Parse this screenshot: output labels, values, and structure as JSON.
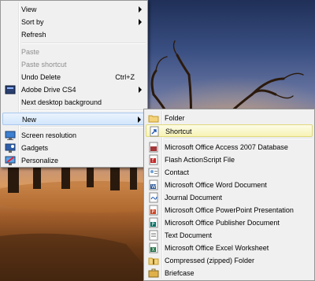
{
  "context_menu": {
    "items": [
      {
        "label": "View",
        "accel": "",
        "submenu": true,
        "disabled": false
      },
      {
        "label": "Sort by",
        "accel": "",
        "submenu": true,
        "disabled": false
      },
      {
        "label": "Refresh",
        "accel": "",
        "submenu": false,
        "disabled": false
      },
      {
        "label": "Paste",
        "accel": "",
        "submenu": false,
        "disabled": true
      },
      {
        "label": "Paste shortcut",
        "accel": "",
        "submenu": false,
        "disabled": true
      },
      {
        "label": "Undo Delete",
        "accel": "Ctrl+Z",
        "submenu": false,
        "disabled": false
      },
      {
        "label": "Adobe Drive CS4",
        "accel": "",
        "submenu": true,
        "disabled": false,
        "icon": "adobe-drive-icon"
      },
      {
        "label": "Next desktop background",
        "accel": "",
        "submenu": false,
        "disabled": false
      },
      {
        "label": "New",
        "accel": "",
        "submenu": true,
        "disabled": false,
        "highlighted": true
      },
      {
        "label": "Screen resolution",
        "accel": "",
        "submenu": false,
        "disabled": false,
        "icon": "screen-resolution-icon"
      },
      {
        "label": "Gadgets",
        "accel": "",
        "submenu": false,
        "disabled": false,
        "icon": "gadgets-icon"
      },
      {
        "label": "Personalize",
        "accel": "",
        "submenu": false,
        "disabled": false,
        "icon": "personalize-icon"
      }
    ]
  },
  "new_submenu": {
    "items": [
      {
        "label": "Folder",
        "icon": "folder-icon"
      },
      {
        "label": "Shortcut",
        "icon": "shortcut-icon",
        "highlighted": true
      },
      {
        "label": "Microsoft Office Access 2007 Database",
        "icon": "access-database-icon"
      },
      {
        "label": "Flash ActionScript File",
        "icon": "flash-file-icon"
      },
      {
        "label": "Contact",
        "icon": "contact-icon"
      },
      {
        "label": "Microsoft Office Word Document",
        "icon": "word-document-icon"
      },
      {
        "label": "Journal Document",
        "icon": "journal-document-icon"
      },
      {
        "label": "Microsoft Office PowerPoint Presentation",
        "icon": "powerpoint-icon"
      },
      {
        "label": "Microsoft Office Publisher Document",
        "icon": "publisher-icon"
      },
      {
        "label": "Text Document",
        "icon": "text-document-icon"
      },
      {
        "label": "Microsoft Office Excel Worksheet",
        "icon": "excel-worksheet-icon"
      },
      {
        "label": "Compressed (zipped) Folder",
        "icon": "zip-folder-icon"
      },
      {
        "label": "Briefcase",
        "icon": "briefcase-icon"
      }
    ]
  }
}
